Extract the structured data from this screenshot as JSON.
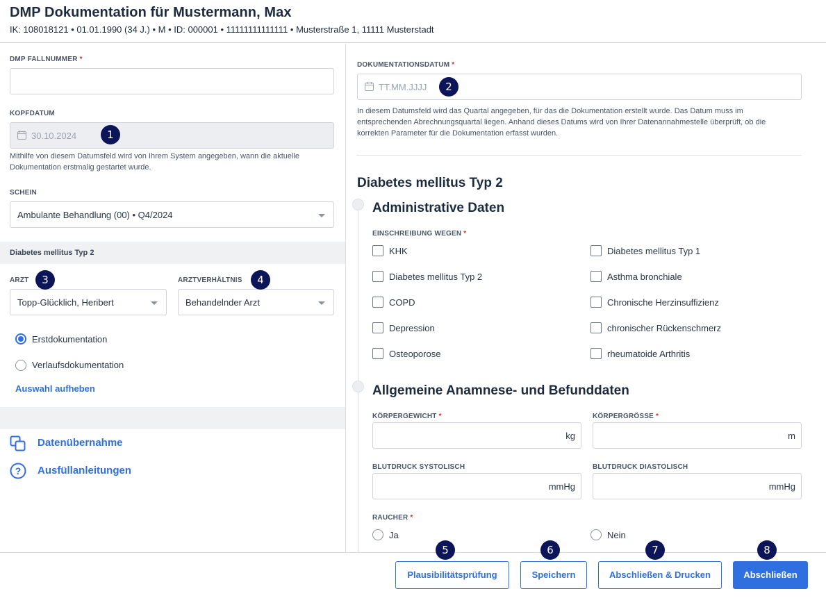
{
  "header": {
    "title": "DMP Dokumentation für Mustermann, Max",
    "subtitle": "IK: 108018121 • 01.01.1990 (34 J.) • M • ID: 000001 • 11111111111111 • Musterstraße 1, 11111 Musterstadt"
  },
  "left": {
    "fallnummer_label": "DMP FALLNUMMER",
    "fallnummer_value": "",
    "kopfdatum_label": "KOPFDATUM",
    "kopfdatum_value": "30.10.2024",
    "kopfdatum_help": "Mithilfe von diesem Datumsfeld wird von Ihrem System angegeben, wann die aktuelle Dokumentation erstmalig gestartet wurde.",
    "schein_label": "SCHEIN",
    "schein_value": "Ambulante Behandlung (00) • Q4/2024",
    "section_title": "Diabetes mellitus Typ 2",
    "arzt_label": "ARZT",
    "arzt_value": "Topp-Glücklich, Heribert",
    "arztverhaeltnis_label": "ARZTVERHÄLTNIS",
    "arztverhaeltnis_value": "Behandelnder Arzt",
    "radio_erst": "Erstdokumentation",
    "radio_verlauf": "Verlaufsdokumentation",
    "radio_selected": "Erstdokumentation",
    "clear_selection": "Auswahl aufheben",
    "datenuebernahme": "Datenübernahme",
    "ausfuellanleitungen": "Ausfüllanleitungen"
  },
  "right": {
    "dokdatum_label": "DOKUMENTATIONSDATUM",
    "dokdatum_placeholder": "TT.MM.JJJJ",
    "dokdatum_help_1": "In diesem Datumsfeld wird das Quartal angegeben, für das die Dokumentation erstellt wurde. Das Datum muss im",
    "dokdatum_help_2": "entsprechenden Abrechnungsquartal liegen. Anhand dieses Datums wird von Ihrer Datenannahmestelle überprüft, ob die",
    "dokdatum_help_3": "korrekten Parameter für die Dokumentation erfasst wurden.",
    "disease_title": "Diabetes mellitus Typ 2",
    "admin_title": "Administrative Daten",
    "einschreibung_label": "EINSCHREIBUNG WEGEN",
    "checkboxes": [
      "KHK",
      "Diabetes mellitus Typ 1",
      "Diabetes mellitus Typ 2",
      "Asthma bronchiale",
      "COPD",
      "Chronische Herzinsuffizienz",
      "Depression",
      "chronischer Rückenschmerz",
      "Osteoporose",
      "rheumatoide Arthritis"
    ],
    "anamnese_title": "Allgemeine Anamnese- und Befunddaten",
    "gewicht_label": "KÖRPERGEWICHT",
    "gewicht_unit": "kg",
    "groesse_label": "KÖRPERGRÖSSE",
    "groesse_unit": "m",
    "systolisch_label": "BLUTDRUCK SYSTOLISCH",
    "systolisch_unit": "mmHg",
    "diastolisch_label": "BLUTDRUCK DIASTOLISCH",
    "diastolisch_unit": "mmHg",
    "raucher_label": "RAUCHER",
    "raucher_ja": "Ja",
    "raucher_nein": "Nein"
  },
  "footer": {
    "plausi": "Plausibilitätsprüfung",
    "speichern": "Speichern",
    "abschliessen_drucken": "Abschließen & Drucken",
    "abschliessen": "Abschließen"
  },
  "badges": [
    "1",
    "2",
    "3",
    "4",
    "5",
    "6",
    "7",
    "8"
  ],
  "colors": {
    "accent": "#2f6fe0",
    "badge": "#0b1557",
    "required": "#d0342c"
  }
}
